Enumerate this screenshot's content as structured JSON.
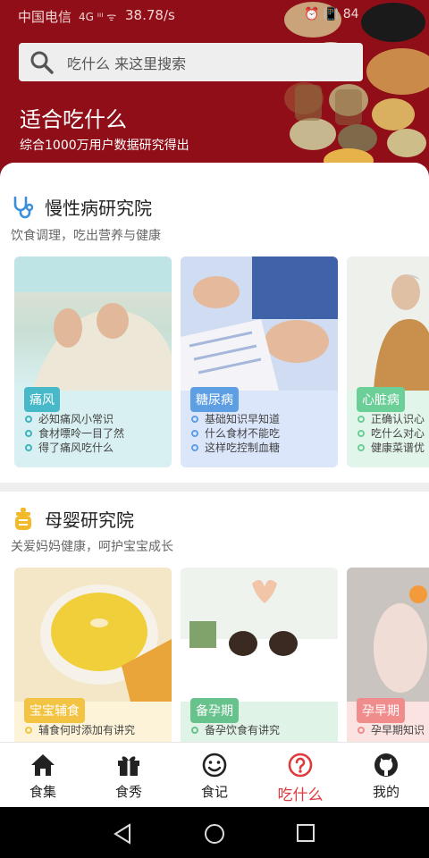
{
  "status_bar": {
    "carrier": "中国电信",
    "signal": "4G ᴵᴵᴵ ᯤ",
    "speed": "38.78/s",
    "right_icons": "⏰ 📳 84"
  },
  "header": {
    "search_placeholder": "吃什么 来这里搜索",
    "title": "适合吃什么",
    "subtitle": "综合1000万用户数据研究得出"
  },
  "sections": [
    {
      "title": "慢性病研究院",
      "desc": "饮食调理，吃出营养与健康",
      "cards": [
        {
          "tag": "痛风",
          "tag_color": "#47b9c8",
          "items": [
            "必知痛风小常识",
            "食材嘌呤一目了然",
            "得了痛风吃什么"
          ]
        },
        {
          "tag": "糖尿病",
          "tag_color": "#5d9fe2",
          "items": [
            "基础知识早知道",
            "什么食材不能吃",
            "这样吃控制血糖"
          ]
        },
        {
          "tag": "心脏病",
          "tag_color": "#6ccf98",
          "items": [
            "正确认识心",
            "吃什么对心",
            "健康菜谱优"
          ]
        }
      ]
    },
    {
      "title": "母婴研究院",
      "desc": "关爱妈妈健康，呵护宝宝成长",
      "cards": [
        {
          "tag": "宝宝辅食",
          "tag_color": "#f3c443",
          "items": [
            "辅食何时添加有讲究"
          ]
        },
        {
          "tag": "备孕期",
          "tag_color": "#68c28c",
          "items": [
            "备孕饮食有讲究"
          ]
        },
        {
          "tag": "孕早期",
          "tag_color": "#f08c8c",
          "items": [
            "孕早期知识"
          ]
        }
      ]
    }
  ],
  "tabs": [
    {
      "label": "食集",
      "icon": "home-icon",
      "active": false
    },
    {
      "label": "食秀",
      "icon": "gift-icon",
      "active": false
    },
    {
      "label": "食记",
      "icon": "smiley-icon",
      "active": false
    },
    {
      "label": "吃什么",
      "icon": "question-icon",
      "active": true
    },
    {
      "label": "我的",
      "icon": "github-cat-icon",
      "active": false
    }
  ],
  "colors": {
    "header_bg": "#8f0e18",
    "accent": "#e0393b",
    "section1_icon": "#3b8fd9",
    "section2_icon": "#f2b92a"
  }
}
